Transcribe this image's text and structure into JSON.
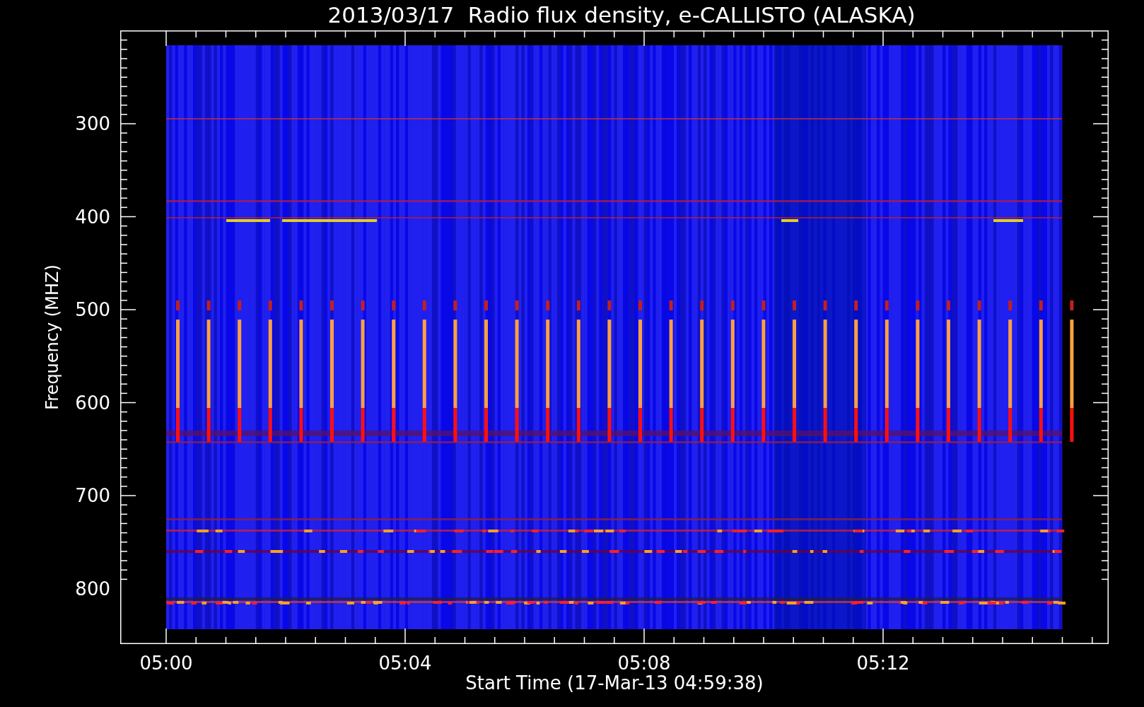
{
  "title": "2013/03/17  Radio flux density, e-CALLISTO (ALASKA)",
  "y_axis": {
    "label": "Frequency (MHZ)",
    "ticks": [
      "300",
      "400",
      "500",
      "600",
      "700",
      "800"
    ]
  },
  "x_axis": {
    "label": "Start Time (17-Mar-13 04:59:38)",
    "ticks": [
      "05:00",
      "05:04",
      "05:08",
      "05:12"
    ]
  }
}
